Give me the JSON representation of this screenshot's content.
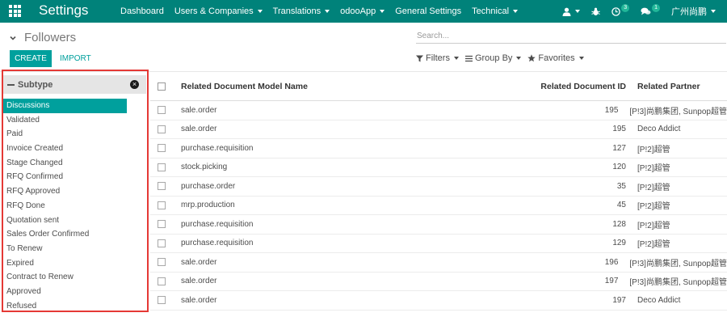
{
  "navbar": {
    "app_title": "Settings",
    "menu": [
      "Dashboard",
      "Users & Companies",
      "Translations",
      "odooApp",
      "General Settings",
      "Technical"
    ],
    "menu_has_caret": [
      false,
      true,
      true,
      true,
      false,
      true
    ],
    "activity_count": "3",
    "message_count": "1",
    "user_name": "广州尚鹏",
    "icons": [
      "apps-icon",
      "user-icon",
      "bug-icon",
      "clock-icon",
      "chat-icon"
    ]
  },
  "control_panel": {
    "title": "Followers",
    "search_placeholder": "Search...",
    "create_label": "CREATE",
    "import_label": "IMPORT",
    "filters_label": "Filters",
    "groupby_label": "Group By",
    "favorites_label": "Favorites"
  },
  "side_panel": {
    "title": "Subtype",
    "items": [
      "Discussions",
      "Validated",
      "Paid",
      "Invoice Created",
      "Stage Changed",
      "RFQ Confirmed",
      "RFQ Approved",
      "RFQ Done",
      "Quotation sent",
      "Sales Order Confirmed",
      "To Renew",
      "Expired",
      "Contract to Renew",
      "Approved",
      "Refused"
    ],
    "active_item": "Discussions"
  },
  "list": {
    "columns": [
      "Related Document Model Name",
      "Related Document ID",
      "Related Partner"
    ],
    "rows": [
      {
        "model": "sale.order",
        "doc_id": "195",
        "partner": "[P!3]尚鹏集团, Sunpop超管"
      },
      {
        "model": "sale.order",
        "doc_id": "195",
        "partner": "Deco Addict"
      },
      {
        "model": "purchase.requisition",
        "doc_id": "127",
        "partner": "[P!2]超管"
      },
      {
        "model": "stock.picking",
        "doc_id": "120",
        "partner": "[P!2]超管"
      },
      {
        "model": "purchase.order",
        "doc_id": "35",
        "partner": "[P!2]超管"
      },
      {
        "model": "mrp.production",
        "doc_id": "45",
        "partner": "[P!2]超管"
      },
      {
        "model": "purchase.requisition",
        "doc_id": "128",
        "partner": "[P!2]超管"
      },
      {
        "model": "purchase.requisition",
        "doc_id": "129",
        "partner": "[P!2]超管"
      },
      {
        "model": "sale.order",
        "doc_id": "196",
        "partner": "[P!3]尚鹏集团, Sunpop超管"
      },
      {
        "model": "sale.order",
        "doc_id": "197",
        "partner": "[P!3]尚鹏集团, Sunpop超管"
      },
      {
        "model": "sale.order",
        "doc_id": "197",
        "partner": "Deco Addict"
      }
    ]
  },
  "colors": {
    "navbar": "#00827a",
    "accent": "#00a09d",
    "highlight_frame": "#e53935"
  }
}
